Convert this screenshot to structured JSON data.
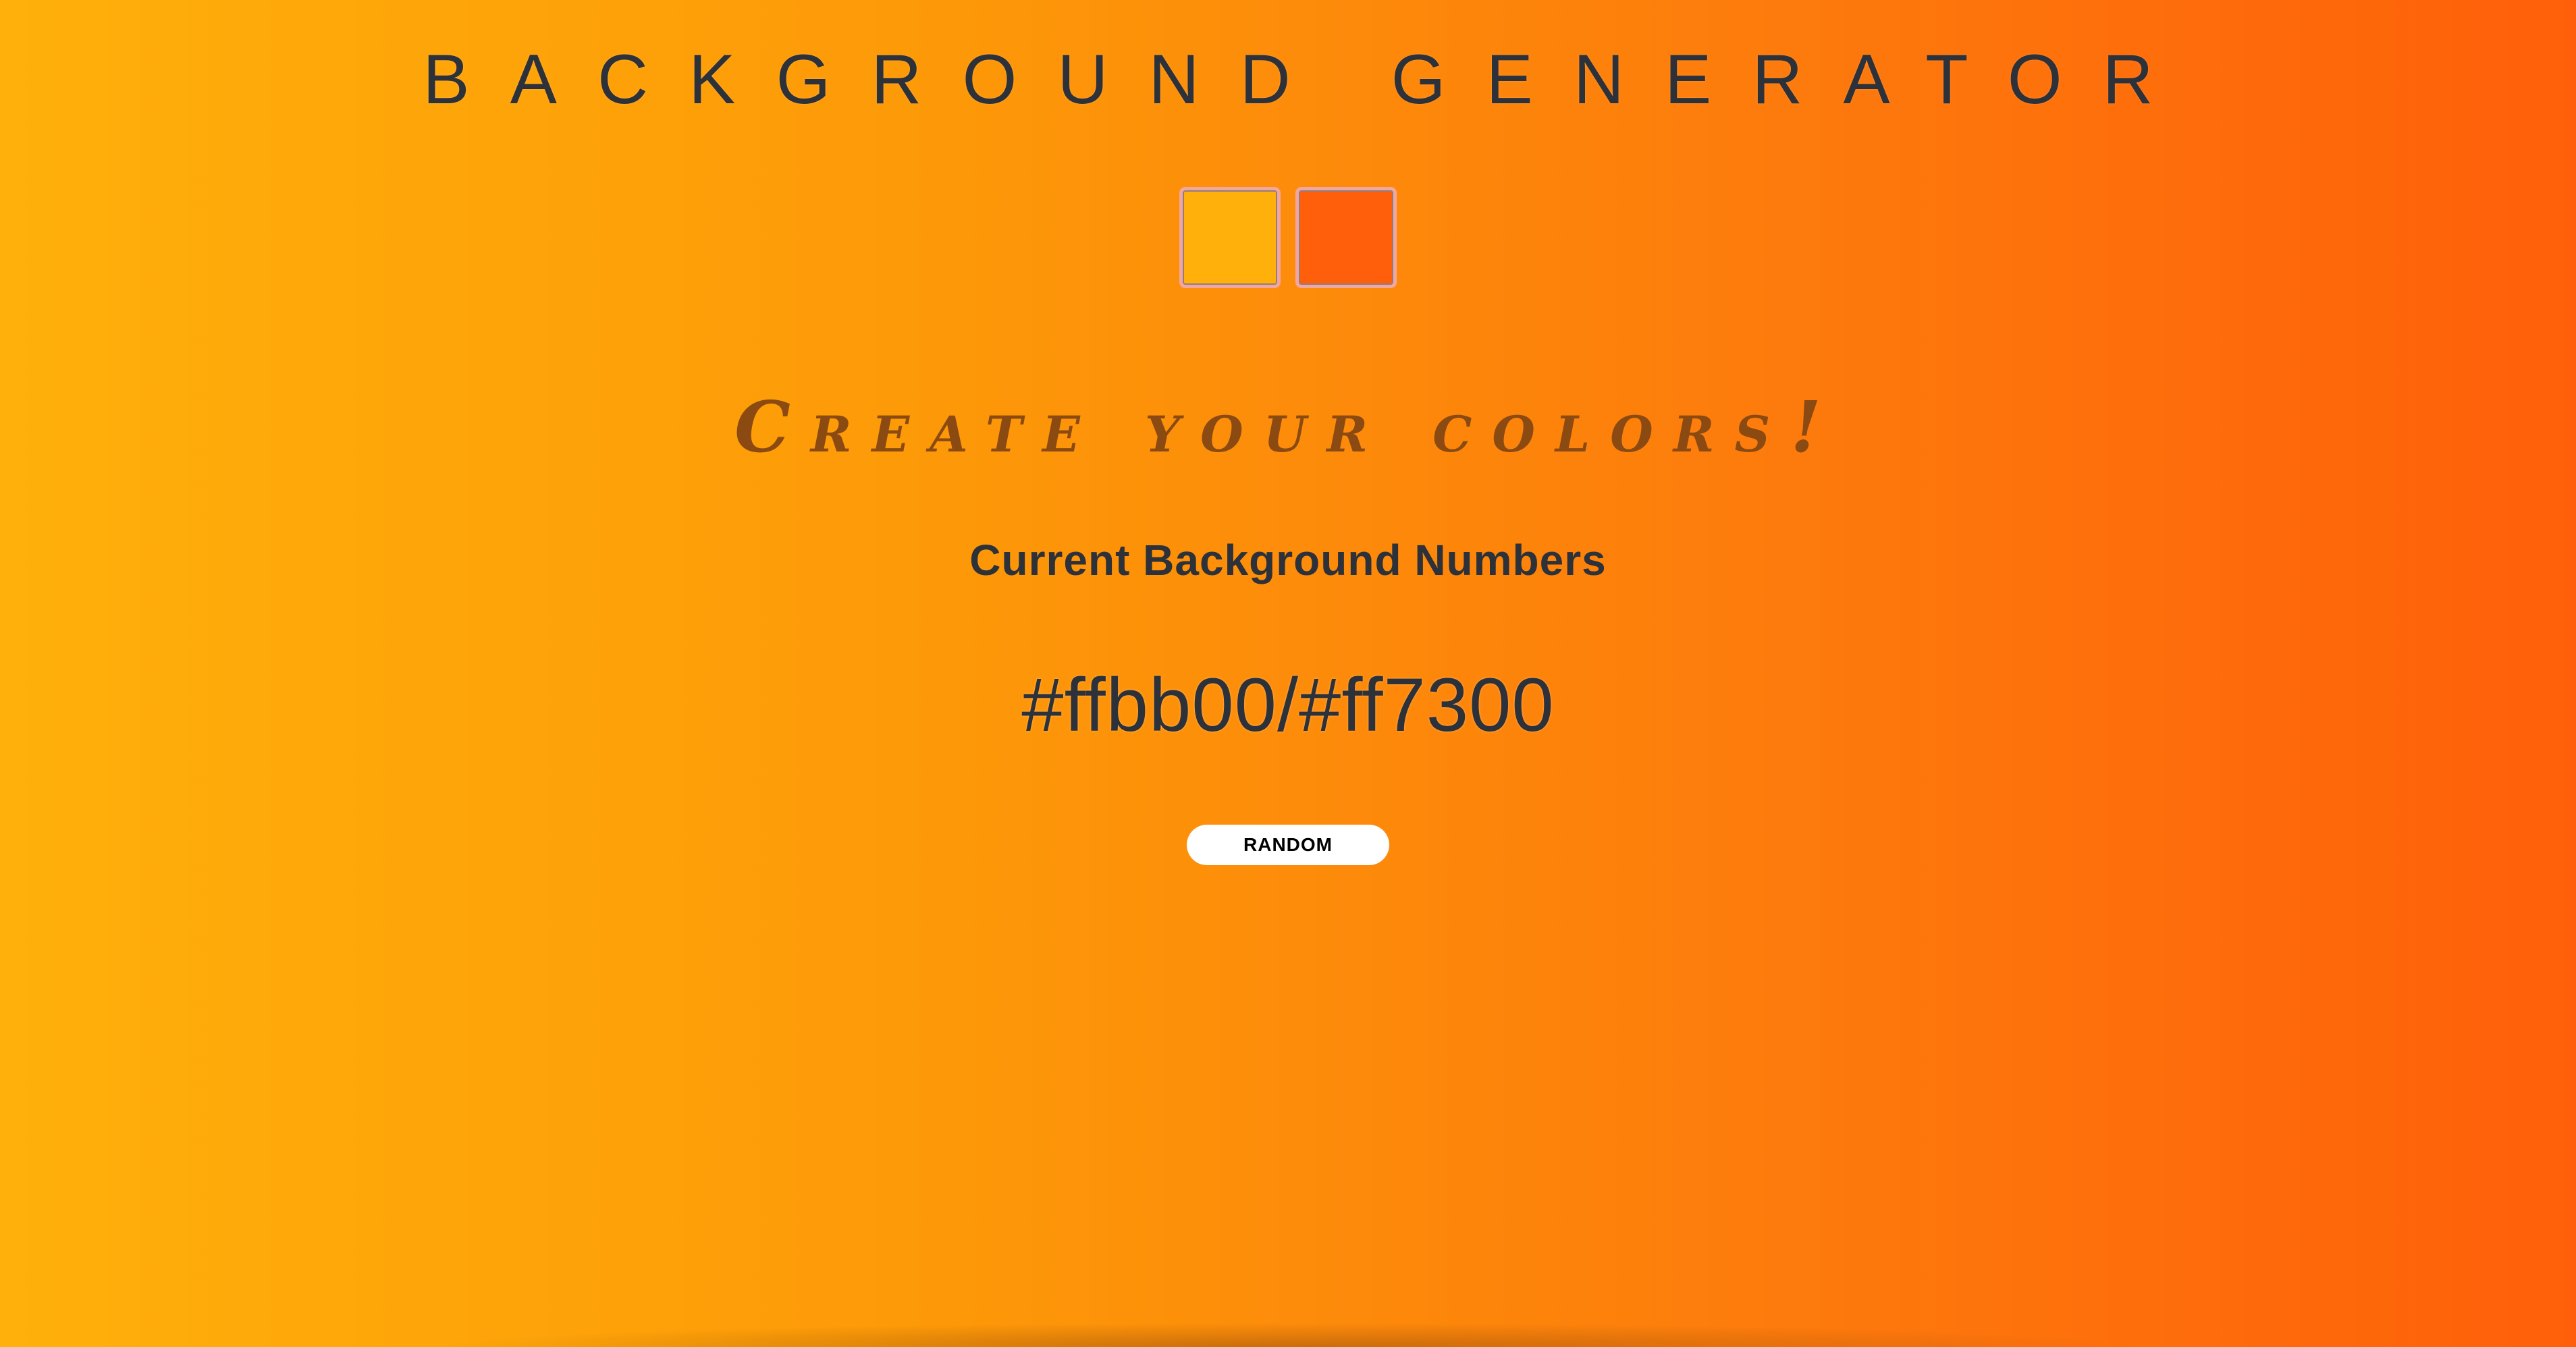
{
  "header": {
    "title": "BACKGROUND GENERATOR"
  },
  "color_inputs": {
    "color1": "#ffb00a",
    "color2": "#ff5f0a"
  },
  "subtitle": "Create your colors!",
  "numbers_heading": "Current Background Numbers",
  "hex_value": "#ffbb00/#ff7300",
  "random_button_label": "RANDOM"
}
